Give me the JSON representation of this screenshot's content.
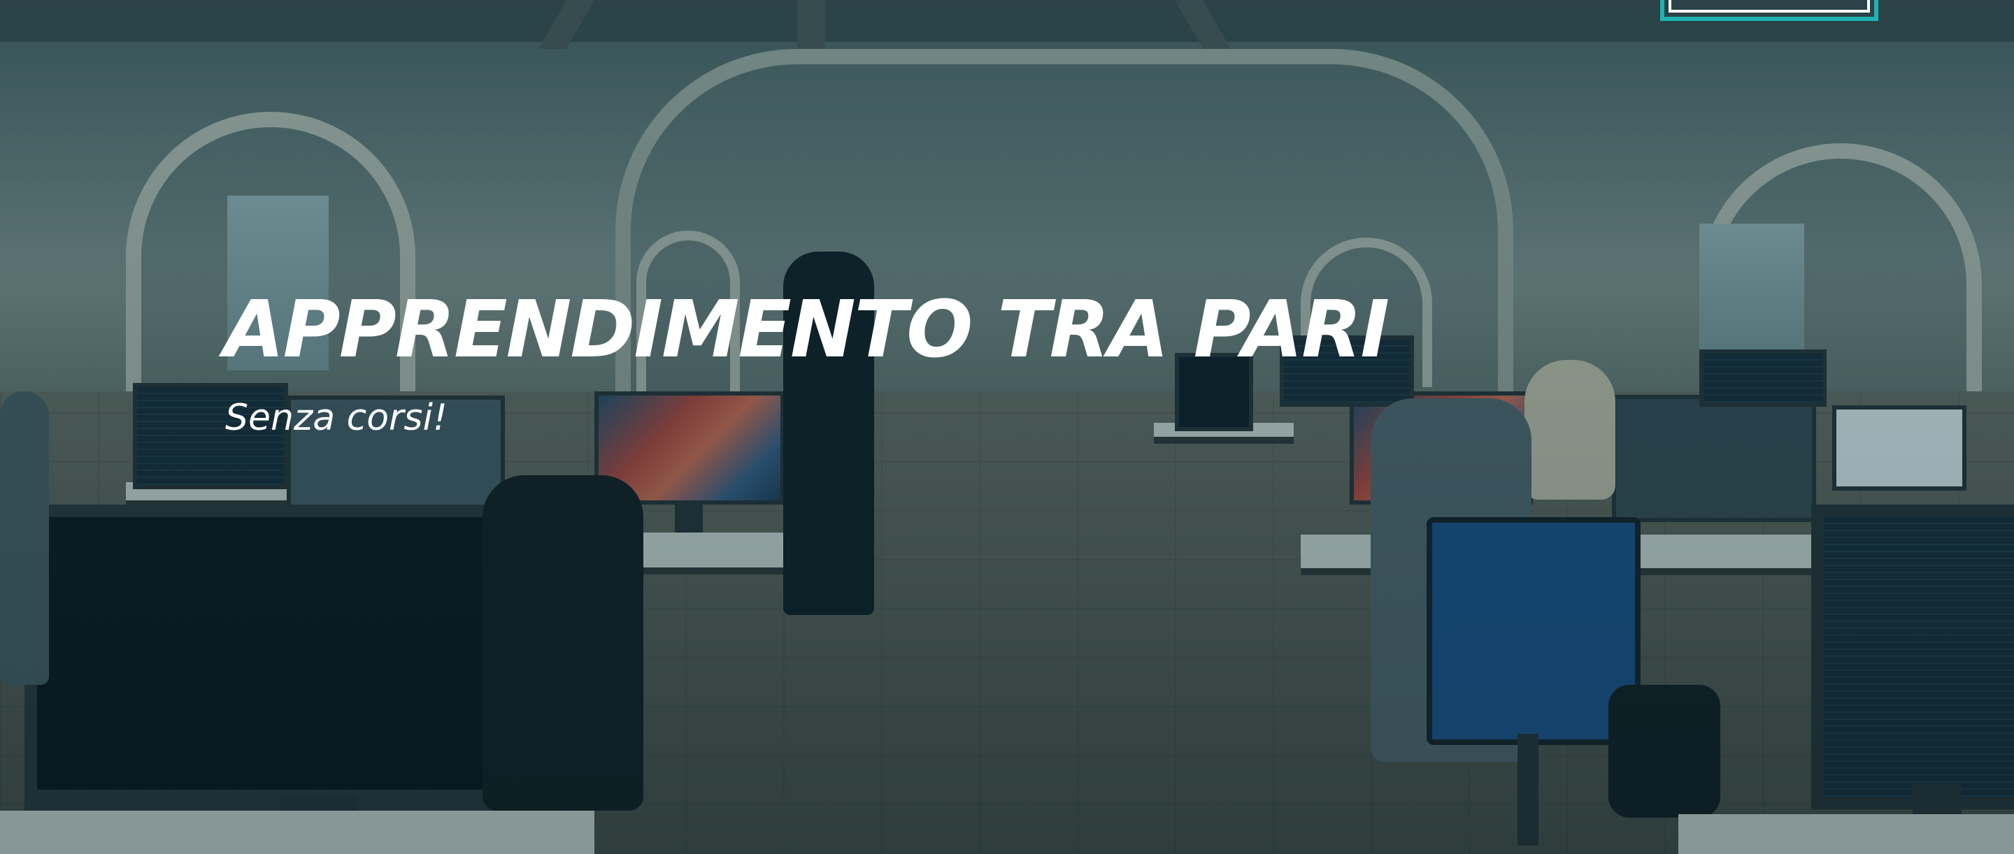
{
  "hero": {
    "headline": "APPRENDIMENTO TRA PARI",
    "subheadline": "Senza corsi!"
  },
  "colors": {
    "accent": "#1fb3b6",
    "text": "#ffffff",
    "overlay_tint": "#0a3c46"
  },
  "top_button": {
    "label": ""
  }
}
